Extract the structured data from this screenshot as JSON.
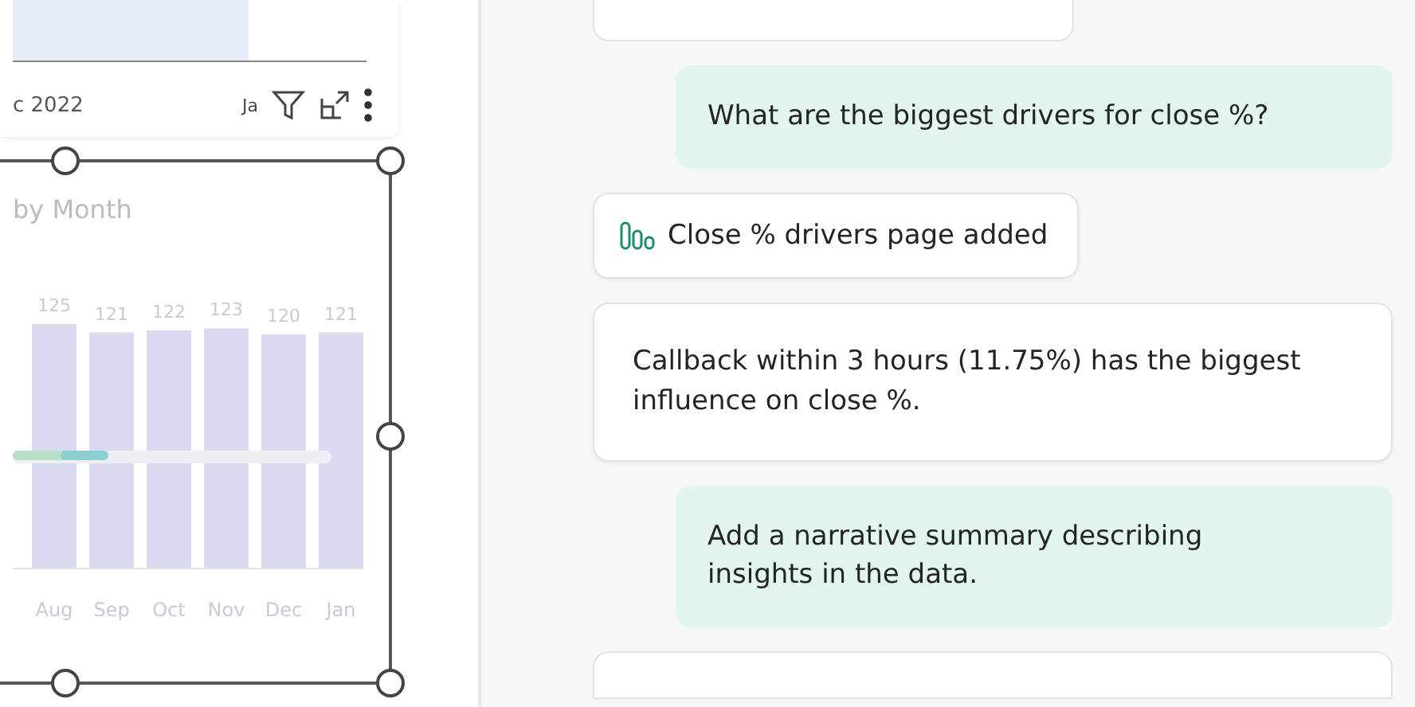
{
  "report": {
    "date_label": "c 2022",
    "toolbar_text": "Ja",
    "chart_title": "by Month",
    "chart_data": {
      "type": "bar",
      "categories": [
        "Aug",
        "Sep",
        "Oct",
        "Nov",
        "Dec",
        "Jan"
      ],
      "values": [
        125,
        121,
        122,
        123,
        120,
        121
      ],
      "data_labels": true
    }
  },
  "chat": {
    "messages": [
      {
        "kind": "stub"
      },
      {
        "kind": "user",
        "text": "What are the biggest drivers for close %?"
      },
      {
        "kind": "status",
        "text": "Close % drivers page added"
      },
      {
        "kind": "bot",
        "text": "Callback within 3 hours (11.75%) has the biggest influence on close %."
      },
      {
        "kind": "user",
        "text": "Add a narrative summary describing insights in the data."
      },
      {
        "kind": "stub"
      }
    ]
  }
}
